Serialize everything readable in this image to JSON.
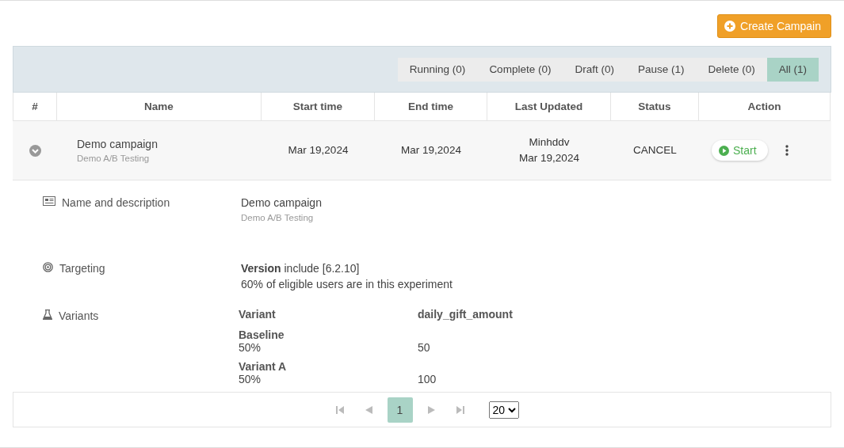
{
  "create_button": {
    "label": "Create Campain"
  },
  "filters": [
    {
      "label": "Running (0)",
      "selected": false
    },
    {
      "label": "Complete (0)",
      "selected": false
    },
    {
      "label": "Draft (0)",
      "selected": false
    },
    {
      "label": "Pause (1)",
      "selected": false
    },
    {
      "label": "Delete (0)",
      "selected": false
    },
    {
      "label": "All (1)",
      "selected": true
    }
  ],
  "table": {
    "columns": [
      "#",
      "Name",
      "Start time",
      "End time",
      "Last Updated",
      "Status",
      "Action"
    ],
    "rows": [
      {
        "expanded": true,
        "name": "Demo campaign",
        "description": "Demo A/B Testing",
        "start_time": "Mar 19,2024",
        "end_time": "Mar 19,2024",
        "updated_by": "Minhddv",
        "updated_at": "Mar 19,2024",
        "status": "CANCEL",
        "action": "Start"
      }
    ]
  },
  "details": [
    {
      "kind": "description",
      "label": "Name and description",
      "lines": [
        {
          "kind": "title",
          "text": "Demo campaign"
        },
        {
          "kind": "note",
          "text": "Demo A/B Testing"
        }
      ]
    },
    {
      "kind": "targeting",
      "label": "Targeting",
      "lines": [
        {
          "kind": "text",
          "text": "**Version** include [6.2.10]"
        },
        {
          "kind": "text",
          "text": "60% of eligible users are in this experiment"
        }
      ]
    },
    {
      "kind": "variants",
      "label": "Variants",
      "table": {
        "columns": [
          "Variant",
          "daily_gift_amount"
        ],
        "rows": [
          {
            "name": "Baseline",
            "share": "50%",
            "value": "50"
          },
          {
            "name": "Variant A",
            "share": "50%",
            "value": "100"
          }
        ]
      }
    }
  ],
  "pagination": {
    "nav": [
      {
        "kind": "first",
        "disabled": true
      },
      {
        "kind": "prev",
        "disabled": true
      },
      {
        "kind": "next",
        "disabled": true
      },
      {
        "kind": "last",
        "disabled": true
      }
    ],
    "pages": [
      {
        "label": "1",
        "selected": true
      }
    ],
    "page_size": "20"
  }
}
